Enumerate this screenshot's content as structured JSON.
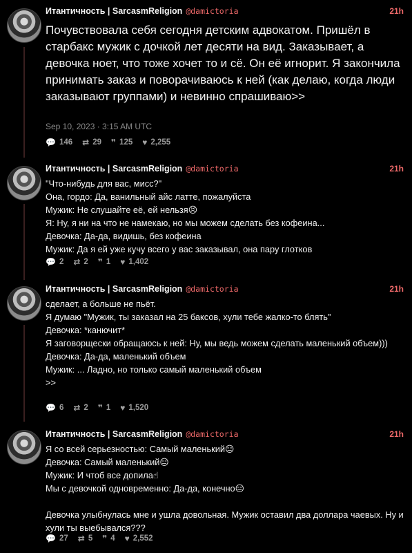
{
  "posts": [
    {
      "name": "Итантичность | SarcasmReligion",
      "handle": "@damictoria",
      "time": "21h",
      "text": "Почувствовала себя сегодня детским адвокатом. Пришёл в старбакс мужик с дочкой лет десяти на вид. Заказывает, а девочка ноет, что тоже хочет то и сё. Он её игнорит. Я закончила принимать заказ и поворачиваюсь к ней (как делаю, когда люди заказывают группами) и невинно спрашиваю>>",
      "date": "Sep 10, 2023 · 3:15 AM UTC",
      "replies": "146",
      "reposts": "29",
      "quotes": "125",
      "likes": "2,255"
    },
    {
      "name": "Итантичность | SarcasmReligion",
      "handle": "@damictoria",
      "time": "21h",
      "text": "\"Что-нибудь для вас, мисс?\"\nОна, гордо: Да, ванильный айс латте, пожалуйста\nМужик: Не слушайте её, ей нельзя😣\nЯ: Ну, я ни на что не намекаю, но мы можем сделать без кофеина...\nДевочка: Да-да, видишь, без кофеина\nМужик: Да я ей уже кучу всего у вас заказывал, она пару глотков",
      "replies": "2",
      "reposts": "2",
      "quotes": "1",
      "likes": "1,402"
    },
    {
      "name": "Итантичность | SarcasmReligion",
      "handle": "@damictoria",
      "time": "21h",
      "text": "сделает, а больше не пьёт.\nЯ думаю \"Мужик, ты заказал на 25 баксов, хули тебе жалко-то блять\"\nДевочка: *канючит*\nЯ заговорщески обращаюсь к ней: Ну, мы ведь можем сделать маленький объем)))\nДевочка: Да-да, маленький объем\nМужик: ... Ладно, но только самый маленький объем\n>>",
      "replies": "6",
      "reposts": "2",
      "quotes": "1",
      "likes": "1,520"
    },
    {
      "name": "Итантичность | SarcasmReligion",
      "handle": "@damictoria",
      "time": "21h",
      "text": "Я со всей серьезностью: Самый маленький😑\nДевочка: Самый маленький😑\nМужик: И чтоб все допила☝\nМы с девочкой одновременно: Да-да, конечно😑\n\nДевочка улыбнулась мне и ушла довольная. Мужик оставил два доллара чаевых. Ну и хули ты выебывался???",
      "replies": "27",
      "reposts": "5",
      "quotes": "4",
      "likes": "2,552"
    }
  ],
  "icons": {
    "reply": "chat-bubble-icon",
    "repost": "repost-icon",
    "quote": "quote-icon",
    "like": "heart-icon"
  },
  "colors": {
    "accent": "#f06a6a",
    "background": "#000000",
    "thread_line": "#3a1f1f"
  }
}
